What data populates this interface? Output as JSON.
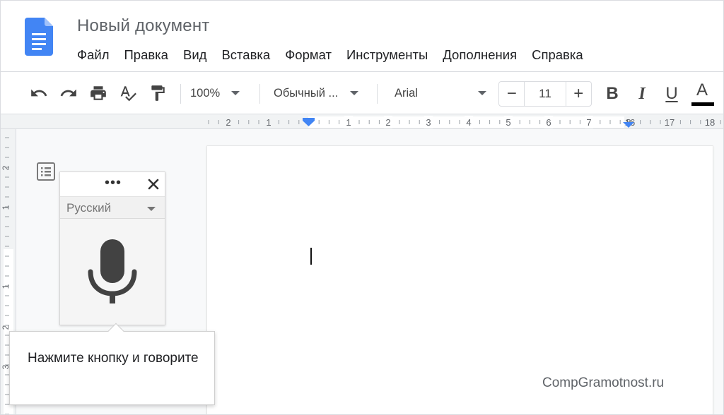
{
  "document": {
    "title": "Новый документ"
  },
  "menu": [
    "Файл",
    "Правка",
    "Вид",
    "Вставка",
    "Формат",
    "Инструменты",
    "Дополнения",
    "Справка"
  ],
  "toolbar": {
    "zoom": "100%",
    "style": "Обычный ...",
    "font": "Arial",
    "font_size": "11",
    "minus": "−",
    "plus": "+",
    "bold": "B",
    "italic": "I",
    "underline": "U",
    "text_color_label": "A",
    "text_color": "#000000",
    "icons": [
      "undo-icon",
      "redo-icon",
      "print-icon",
      "spellcheck-icon",
      "paint-format-icon"
    ]
  },
  "ruler": {
    "labels": [
      "2",
      "1",
      "1",
      "2",
      "3",
      "4",
      "5",
      "6",
      "7",
      "8",
      "16",
      "17",
      "18"
    ],
    "vertical_labels": [
      "2",
      "1",
      "1",
      "2",
      "3"
    ],
    "accent": "#4285f4"
  },
  "voice_typing": {
    "more": "•••",
    "language": "Русский",
    "icons": [
      "more-icon",
      "close-icon",
      "microphone-icon"
    ]
  },
  "tooltip": {
    "text": "Нажмите кнопку и говорите"
  },
  "watermark": "CompGramotnost.ru",
  "colors": {
    "docs_blue": "#4285f4",
    "mic": "#424242"
  }
}
